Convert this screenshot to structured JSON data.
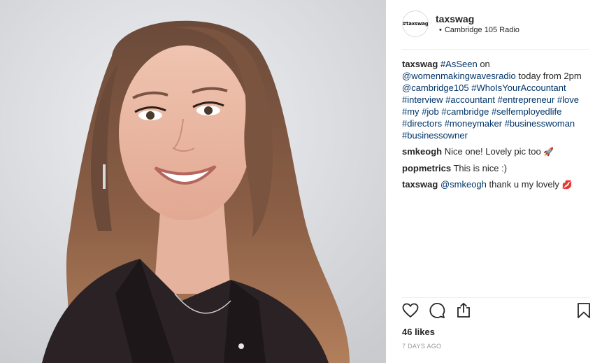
{
  "post": {
    "username": "taxswag",
    "avatar_text": "#taxswag",
    "location": "Cambridge 105 Radio",
    "location_bullet": "•"
  },
  "caption": {
    "username": "taxswag",
    "segments": [
      {
        "text": "#AsSeen",
        "type": "tag"
      },
      {
        "text": " on ",
        "type": "text"
      },
      {
        "text": "@womenmakingwavesradio",
        "type": "tag"
      },
      {
        "text": " today from 2pm ",
        "type": "text"
      },
      {
        "text": "@cambridge105",
        "type": "tag"
      },
      {
        "text": " ",
        "type": "text"
      },
      {
        "text": "#WhoIsYourAccountant",
        "type": "tag"
      },
      {
        "text": " ",
        "type": "text"
      },
      {
        "text": "#interview",
        "type": "tag"
      },
      {
        "text": " ",
        "type": "text"
      },
      {
        "text": "#accountant",
        "type": "tag"
      },
      {
        "text": " ",
        "type": "text"
      },
      {
        "text": "#entrepreneur",
        "type": "tag"
      },
      {
        "text": " ",
        "type": "text"
      },
      {
        "text": "#love",
        "type": "tag"
      },
      {
        "text": " ",
        "type": "text"
      },
      {
        "text": "#my",
        "type": "tag"
      },
      {
        "text": " ",
        "type": "text"
      },
      {
        "text": "#job",
        "type": "tag"
      },
      {
        "text": " ",
        "type": "text"
      },
      {
        "text": "#cambridge",
        "type": "tag"
      },
      {
        "text": " ",
        "type": "text"
      },
      {
        "text": "#selfemployedlife",
        "type": "tag"
      },
      {
        "text": " ",
        "type": "text"
      },
      {
        "text": "#directors",
        "type": "tag"
      },
      {
        "text": " ",
        "type": "text"
      },
      {
        "text": "#moneymaker",
        "type": "tag"
      },
      {
        "text": " ",
        "type": "text"
      },
      {
        "text": "#businesswoman",
        "type": "tag"
      },
      {
        "text": " ",
        "type": "text"
      },
      {
        "text": "#businessowner",
        "type": "tag"
      }
    ]
  },
  "comments": [
    {
      "username": "smkeogh",
      "mention": "",
      "text": "Nice one! Lovely pic too ",
      "emoji": "🚀"
    },
    {
      "username": "popmetrics",
      "mention": "",
      "text": "This is nice :)",
      "emoji": ""
    },
    {
      "username": "taxswag",
      "mention": "@smkeogh",
      "text": " thank u my lovely ",
      "emoji": "💋"
    }
  ],
  "icons": {
    "like": "heart-icon",
    "comment": "comment-bubble-icon",
    "share": "share-icon",
    "save": "bookmark-icon"
  },
  "likes_label": "46 likes",
  "timestamp": "7 DAYS AGO",
  "colors": {
    "text": "#262626",
    "link": "#003569",
    "muted": "#999999",
    "divider": "#efefef"
  }
}
